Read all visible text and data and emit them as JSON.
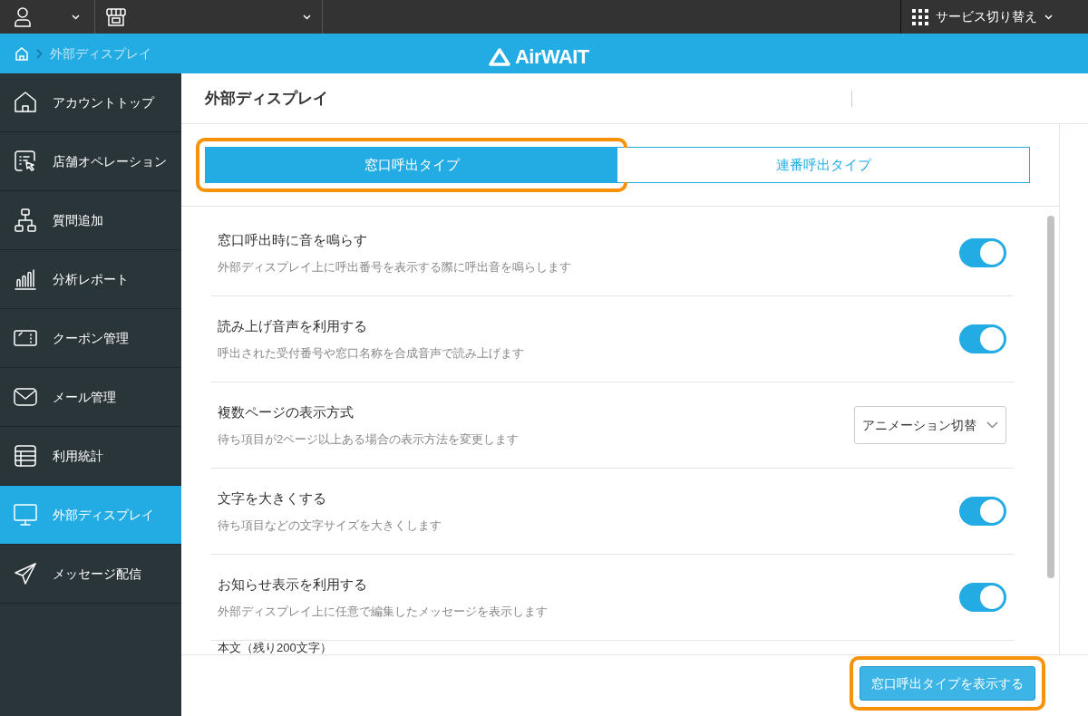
{
  "top_bar": {
    "service_switch": "サービス切り替え"
  },
  "breadcrumb": {
    "current": "外部ディスプレイ"
  },
  "logo": "AirWAIT",
  "sidebar": {
    "items": [
      {
        "label": "アカウントトップ",
        "selected": false
      },
      {
        "label": "店舗オペレーション",
        "selected": false
      },
      {
        "label": "質問追加",
        "selected": false
      },
      {
        "label": "分析レポート",
        "selected": false
      },
      {
        "label": "クーポン管理",
        "selected": false
      },
      {
        "label": "メール管理",
        "selected": false
      },
      {
        "label": "利用統計",
        "selected": false
      },
      {
        "label": "外部ディスプレイ",
        "selected": true
      },
      {
        "label": "メッセージ配信",
        "selected": false
      }
    ]
  },
  "page_title": "外部ディスプレイ",
  "tabs": [
    {
      "label": "窓口呼出タイプ",
      "selected": true,
      "highlighted": true
    },
    {
      "label": "連番呼出タイプ",
      "selected": false,
      "highlighted": false
    }
  ],
  "settings": [
    {
      "kind": "toggle",
      "title": "窓口呼出時に音を鳴らす",
      "description": "外部ディスプレイ上に呼出番号を表示する際に呼出音を鳴らします",
      "on": true
    },
    {
      "kind": "toggle",
      "title": "読み上げ音声を利用する",
      "description": "呼出された受付番号や窓口名称を合成音声で読み上げます",
      "on": true
    },
    {
      "kind": "select",
      "title": "複数ページの表示方式",
      "description": "待ち項目が2ページ以上ある場合の表示方法を変更します",
      "value": "アニメーション切替"
    },
    {
      "kind": "toggle",
      "title": "文字を大きくする",
      "description": "待ち項目などの文字サイズを大きくします",
      "on": true
    },
    {
      "kind": "toggle",
      "title": "お知らせ表示を利用する",
      "description": "外部ディスプレイ上に任意で編集したメッセージを表示します",
      "on": true
    }
  ],
  "message_field": {
    "label": "本文（残り200文字）"
  },
  "footer": {
    "button": "窓口呼出タイプを表示する",
    "highlighted": true
  }
}
